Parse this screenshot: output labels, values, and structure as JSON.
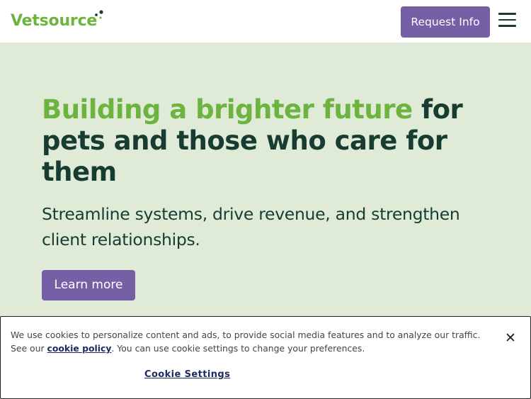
{
  "header": {
    "logo_text": "Vetsource",
    "request_button": "Request Info",
    "menu_icon": "hamburger-menu-icon"
  },
  "hero": {
    "title_accent": "Building a brighter future",
    "title_rest": " for pets and those who care for them",
    "subtitle": "Streamline systems, drive revenue, and strengthen client relationships.",
    "cta_label": "Learn more"
  },
  "cookie_banner": {
    "text_before": "We use cookies to personalize content and ads, to provide social media features and to analyze our traffic. See our ",
    "link_label": "cookie policy",
    "text_after": ". You can use cookie settings to change your preferences.",
    "settings_label": "Cookie Settings",
    "close_icon": "close-icon"
  },
  "colors": {
    "brand_green": "#6cb33f",
    "brand_purple": "#7560a6",
    "dark_green": "#173d33",
    "hero_background": "#dfead7"
  }
}
